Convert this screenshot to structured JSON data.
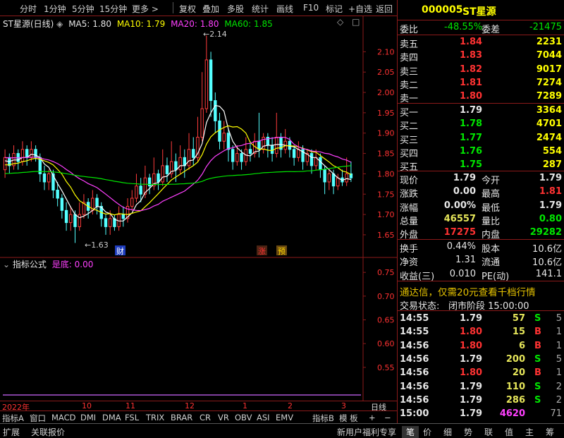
{
  "toolbar": {
    "tabs": [
      "分时",
      "1分钟",
      "5分钟",
      "15分钟",
      "更多 >"
    ],
    "right": [
      "复权",
      "叠加",
      "多股",
      "统计",
      "画线",
      "F10",
      "标记",
      "+自选",
      "返回"
    ]
  },
  "chart_title": {
    "name": "ST星源(日线)",
    "ma5": "MA5: 1.80",
    "ma10": "MA10: 1.79",
    "ma20": "MA20: 1.80",
    "ma60": "MA60: 1.85"
  },
  "annotations": {
    "high": "2.14",
    "low": "1.63",
    "cai": "财",
    "zhang": "涨",
    "yu": "预"
  },
  "indicator": {
    "label": "指标公式",
    "name": "是底",
    "value": "0.00"
  },
  "date_axis": {
    "labels": [
      "2022年",
      "10",
      "11",
      "12",
      "1",
      "2",
      "3"
    ],
    "right": "日线"
  },
  "bottom_tabs": [
    "指标A",
    "窗口",
    "MACD",
    "DMI",
    "DMA",
    "FSL",
    "TRIX",
    "BRAR",
    "CR",
    "VR",
    "OBV",
    "ASI",
    "EMV",
    "指标B",
    "模 板",
    "+",
    "−"
  ],
  "status_bar": {
    "left": [
      "扩展",
      "关联报价"
    ],
    "promo": "新用户福利专享",
    "right_tabs": [
      "笔",
      "价",
      "细",
      "势",
      "联",
      "值",
      "主",
      "筹"
    ]
  },
  "chart_data": {
    "type": "line",
    "title": "ST星源(日线)",
    "ylim": [
      1.61,
      2.17
    ],
    "yticks": [
      1.65,
      1.7,
      1.75,
      1.8,
      1.85,
      1.9,
      1.95,
      2.0,
      2.05,
      2.1
    ],
    "indicator_yticks": [
      0.55,
      0.6,
      0.65,
      0.7,
      0.75
    ],
    "candles": [
      {
        "o": 1.81,
        "c": 1.84,
        "h": 1.86,
        "l": 1.79
      },
      {
        "o": 1.84,
        "c": 1.82,
        "h": 1.85,
        "l": 1.8
      },
      {
        "o": 1.82,
        "c": 1.85,
        "h": 1.87,
        "l": 1.81
      },
      {
        "o": 1.85,
        "c": 1.83,
        "h": 1.86,
        "l": 1.81
      },
      {
        "o": 1.83,
        "c": 1.86,
        "h": 1.88,
        "l": 1.82
      },
      {
        "o": 1.86,
        "c": 1.84,
        "h": 1.87,
        "l": 1.82
      },
      {
        "o": 1.84,
        "c": 1.86,
        "h": 1.88,
        "l": 1.83
      },
      {
        "o": 1.86,
        "c": 1.84,
        "h": 1.87,
        "l": 1.83
      },
      {
        "o": 1.84,
        "c": 1.8,
        "h": 1.85,
        "l": 1.78
      },
      {
        "o": 1.8,
        "c": 1.78,
        "h": 1.82,
        "l": 1.76
      },
      {
        "o": 1.78,
        "c": 1.8,
        "h": 1.81,
        "l": 1.76
      },
      {
        "o": 1.8,
        "c": 1.76,
        "h": 1.81,
        "l": 1.74
      },
      {
        "o": 1.76,
        "c": 1.74,
        "h": 1.78,
        "l": 1.72
      },
      {
        "o": 1.74,
        "c": 1.71,
        "h": 1.75,
        "l": 1.69
      },
      {
        "o": 1.71,
        "c": 1.68,
        "h": 1.73,
        "l": 1.66
      },
      {
        "o": 1.68,
        "c": 1.7,
        "h": 1.72,
        "l": 1.66
      },
      {
        "o": 1.7,
        "c": 1.67,
        "h": 1.71,
        "l": 1.63
      },
      {
        "o": 1.67,
        "c": 1.7,
        "h": 1.73,
        "l": 1.66
      },
      {
        "o": 1.7,
        "c": 1.73,
        "h": 1.75,
        "l": 1.69
      },
      {
        "o": 1.73,
        "c": 1.71,
        "h": 1.74,
        "l": 1.69
      },
      {
        "o": 1.71,
        "c": 1.74,
        "h": 1.76,
        "l": 1.7
      },
      {
        "o": 1.74,
        "c": 1.72,
        "h": 1.75,
        "l": 1.7
      },
      {
        "o": 1.72,
        "c": 1.69,
        "h": 1.73,
        "l": 1.67
      },
      {
        "o": 1.69,
        "c": 1.67,
        "h": 1.7,
        "l": 1.65
      },
      {
        "o": 1.67,
        "c": 1.69,
        "h": 1.71,
        "l": 1.65
      },
      {
        "o": 1.69,
        "c": 1.67,
        "h": 1.7,
        "l": 1.66
      },
      {
        "o": 1.67,
        "c": 1.7,
        "h": 1.72,
        "l": 1.66
      },
      {
        "o": 1.7,
        "c": 1.69,
        "h": 1.72,
        "l": 1.67
      },
      {
        "o": 1.69,
        "c": 1.72,
        "h": 1.74,
        "l": 1.68
      },
      {
        "o": 1.72,
        "c": 1.74,
        "h": 1.76,
        "l": 1.71
      },
      {
        "o": 1.74,
        "c": 1.77,
        "h": 1.8,
        "l": 1.73
      },
      {
        "o": 1.77,
        "c": 1.75,
        "h": 1.79,
        "l": 1.73
      },
      {
        "o": 1.75,
        "c": 1.79,
        "h": 1.82,
        "l": 1.74
      },
      {
        "o": 1.79,
        "c": 1.77,
        "h": 1.8,
        "l": 1.75
      },
      {
        "o": 1.77,
        "c": 1.8,
        "h": 1.84,
        "l": 1.76
      },
      {
        "o": 1.8,
        "c": 1.78,
        "h": 1.81,
        "l": 1.76
      },
      {
        "o": 1.78,
        "c": 1.82,
        "h": 1.86,
        "l": 1.77
      },
      {
        "o": 1.82,
        "c": 1.8,
        "h": 1.84,
        "l": 1.78
      },
      {
        "o": 1.8,
        "c": 1.83,
        "h": 1.88,
        "l": 1.79
      },
      {
        "o": 1.83,
        "c": 1.81,
        "h": 1.85,
        "l": 1.78
      },
      {
        "o": 1.81,
        "c": 1.84,
        "h": 1.87,
        "l": 1.8
      },
      {
        "o": 1.84,
        "c": 1.82,
        "h": 1.86,
        "l": 1.79
      },
      {
        "o": 1.82,
        "c": 1.86,
        "h": 1.9,
        "l": 1.81
      },
      {
        "o": 1.86,
        "c": 1.84,
        "h": 1.89,
        "l": 1.82
      },
      {
        "o": 1.84,
        "c": 1.89,
        "h": 1.94,
        "l": 1.83
      },
      {
        "o": 1.89,
        "c": 1.96,
        "h": 2.05,
        "l": 1.88
      },
      {
        "o": 1.96,
        "c": 2.08,
        "h": 2.14,
        "l": 1.95
      },
      {
        "o": 2.08,
        "c": 1.98,
        "h": 2.1,
        "l": 1.94
      },
      {
        "o": 1.98,
        "c": 1.93,
        "h": 2.0,
        "l": 1.9
      },
      {
        "o": 1.93,
        "c": 1.88,
        "h": 1.95,
        "l": 1.86
      },
      {
        "o": 1.88,
        "c": 1.9,
        "h": 1.93,
        "l": 1.86
      },
      {
        "o": 1.9,
        "c": 1.86,
        "h": 1.91,
        "l": 1.83
      },
      {
        "o": 1.86,
        "c": 1.83,
        "h": 1.87,
        "l": 1.81
      },
      {
        "o": 1.83,
        "c": 1.85,
        "h": 1.87,
        "l": 1.82
      },
      {
        "o": 1.85,
        "c": 1.83,
        "h": 1.86,
        "l": 1.81
      },
      {
        "o": 1.83,
        "c": 1.86,
        "h": 1.89,
        "l": 1.82
      },
      {
        "o": 1.86,
        "c": 1.85,
        "h": 1.88,
        "l": 1.83
      },
      {
        "o": 1.85,
        "c": 1.88,
        "h": 1.9,
        "l": 1.84
      },
      {
        "o": 1.88,
        "c": 1.86,
        "h": 1.95,
        "l": 1.84
      },
      {
        "o": 1.86,
        "c": 1.89,
        "h": 1.9,
        "l": 1.85
      },
      {
        "o": 1.89,
        "c": 1.87,
        "h": 1.9,
        "l": 1.84
      },
      {
        "o": 1.87,
        "c": 1.85,
        "h": 1.89,
        "l": 1.83
      },
      {
        "o": 1.85,
        "c": 1.89,
        "h": 1.95,
        "l": 1.84
      },
      {
        "o": 1.89,
        "c": 1.86,
        "h": 1.9,
        "l": 1.84
      },
      {
        "o": 1.86,
        "c": 1.88,
        "h": 1.91,
        "l": 1.85
      },
      {
        "o": 1.88,
        "c": 1.86,
        "h": 1.89,
        "l": 1.84
      },
      {
        "o": 1.86,
        "c": 1.84,
        "h": 1.87,
        "l": 1.82
      },
      {
        "o": 1.84,
        "c": 1.86,
        "h": 1.88,
        "l": 1.83
      },
      {
        "o": 1.86,
        "c": 1.83,
        "h": 1.87,
        "l": 1.81
      },
      {
        "o": 1.83,
        "c": 1.85,
        "h": 1.86,
        "l": 1.82
      },
      {
        "o": 1.85,
        "c": 1.82,
        "h": 1.86,
        "l": 1.8
      },
      {
        "o": 1.82,
        "c": 1.84,
        "h": 1.86,
        "l": 1.81
      },
      {
        "o": 1.84,
        "c": 1.81,
        "h": 1.85,
        "l": 1.79
      },
      {
        "o": 1.81,
        "c": 1.78,
        "h": 1.82,
        "l": 1.75
      },
      {
        "o": 1.78,
        "c": 1.8,
        "h": 1.81,
        "l": 1.76
      },
      {
        "o": 1.8,
        "c": 1.77,
        "h": 1.81,
        "l": 1.75
      },
      {
        "o": 1.77,
        "c": 1.79,
        "h": 1.8,
        "l": 1.76
      },
      {
        "o": 1.79,
        "c": 1.78,
        "h": 1.81,
        "l": 1.77
      },
      {
        "o": 1.78,
        "c": 1.8,
        "h": 1.84,
        "l": 1.77
      },
      {
        "o": 1.8,
        "c": 1.79,
        "h": 1.83,
        "l": 1.78
      }
    ]
  },
  "quote": {
    "code": "000005",
    "name": "ST星源",
    "weibi_label": "委比",
    "weibi": "-48.55%",
    "weicha_label": "委差",
    "weicha": "-21475",
    "sell": [
      {
        "label": "卖五",
        "price": "1.84",
        "vol": "2231"
      },
      {
        "label": "卖四",
        "price": "1.83",
        "vol": "7044"
      },
      {
        "label": "卖三",
        "price": "1.82",
        "vol": "9017"
      },
      {
        "label": "卖二",
        "price": "1.81",
        "vol": "7274"
      },
      {
        "label": "卖一",
        "price": "1.80",
        "vol": "7289"
      }
    ],
    "buy": [
      {
        "label": "买一",
        "price": "1.79",
        "vol": "3364"
      },
      {
        "label": "买二",
        "price": "1.78",
        "vol": "4701"
      },
      {
        "label": "买三",
        "price": "1.77",
        "vol": "2474"
      },
      {
        "label": "买四",
        "price": "1.76",
        "vol": "554"
      },
      {
        "label": "买五",
        "price": "1.75",
        "vol": "287"
      }
    ],
    "stats": [
      {
        "l1": "现价",
        "v1": "1.79",
        "l2": "今开",
        "v2": "1.79"
      },
      {
        "l1": "涨跌",
        "v1": "0.00",
        "l2": "最高",
        "v2": "1.81"
      },
      {
        "l1": "涨幅",
        "v1": "0.00%",
        "l2": "最低",
        "v2": "1.79"
      },
      {
        "l1": "总量",
        "v1": "46557",
        "l2": "量比",
        "v2": "0.80"
      },
      {
        "l1": "外盘",
        "v1": "17275",
        "l2": "内盘",
        "v2": "29282"
      }
    ],
    "fund": [
      {
        "l1": "换手",
        "v1": "0.44%",
        "l2": "股本",
        "v2": "10.6亿"
      },
      {
        "l1": "净资",
        "v1": "1.31",
        "l2": "流通",
        "v2": "10.6亿"
      },
      {
        "l1": "收益(三)",
        "v1": "0.010",
        "l2": "PE(动)",
        "v2": "141.1"
      }
    ],
    "promo": "通达信，仅需20元查看千档行情",
    "trade_status_label": "交易状态:",
    "trade_status": "闭市阶段 15:00:00",
    "ticks": [
      {
        "t": "14:55",
        "p": "1.79",
        "v": "57",
        "s": "S",
        "n": "5"
      },
      {
        "t": "14:55",
        "p": "1.80",
        "v": "15",
        "s": "B",
        "n": "1"
      },
      {
        "t": "14:56",
        "p": "1.80",
        "v": "6",
        "s": "B",
        "n": "1"
      },
      {
        "t": "14:56",
        "p": "1.79",
        "v": "200",
        "s": "S",
        "n": "5"
      },
      {
        "t": "14:56",
        "p": "1.80",
        "v": "20",
        "s": "B",
        "n": "1"
      },
      {
        "t": "14:56",
        "p": "1.79",
        "v": "110",
        "s": "S",
        "n": "2"
      },
      {
        "t": "14:56",
        "p": "1.79",
        "v": "286",
        "s": "S",
        "n": "2"
      },
      {
        "t": "15:00",
        "p": "1.79",
        "v": "4620",
        "s": "",
        "n": "71"
      }
    ]
  }
}
